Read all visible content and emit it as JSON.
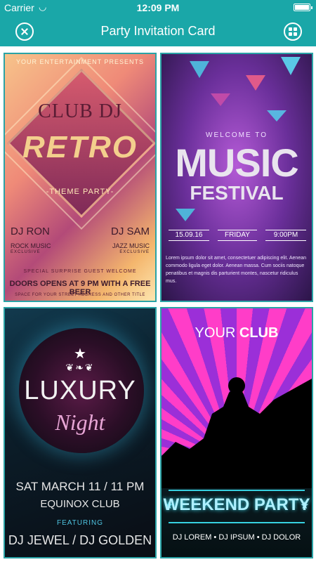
{
  "status_bar": {
    "carrier": "Carrier",
    "time": "12:09 PM"
  },
  "nav": {
    "title": "Party Invitation Card",
    "left_icon": "close-icon",
    "right_icon": "grid-icon"
  },
  "cards": [
    {
      "presents": "YOUR ENTERTAINMENT PRESENTS",
      "club_dj": "CLUB DJ",
      "retro": "RETRO",
      "theme": "-THEME PARTY-",
      "dj_left": "DJ RON",
      "dj_left_genre": "ROCK MUSIC",
      "dj_left_tag": "EXCLUSIVE",
      "dj_right": "DJ SAM",
      "dj_right_genre": "JAZZ MUSIC",
      "dj_right_tag": "EXCLUSIVE",
      "special": "SPECIAL SURPRISE GUEST WELCOME",
      "doors": "DOORS OPENS AT 9 PM WITH A FREE BEER",
      "space": "SPACE FOR YOUR STREET ADDRESS AND OTHER TITLE"
    },
    {
      "welcome": "WELCOME TO",
      "music": "MUSIC",
      "festival": "FESTIVAL",
      "date": "15.09.16",
      "day": "FRIDAY",
      "time": "9:00PM",
      "lorem": "Lorem ipsum dolor sit amet, consectetuer adipiscing elit. Aenean commodo ligula eget dolor. Aenean massa. Cum sociis natoque penatibus et magnis dis parturient montes, nascetur ridiculus mus."
    },
    {
      "luxury": "LUXURY",
      "night": "Night",
      "date": "SAT MARCH 11  / 11 PM",
      "venue": "EQUINOX CLUB",
      "featuring": "FEATURING",
      "djs": "DJ JEWEL / DJ GOLDEN"
    },
    {
      "your": "YOUR ",
      "club": "CLUB",
      "weekend": "WEEKEND PARTY",
      "djs": "DJ LOREM • DJ IPSUM • DJ DOLOR"
    }
  ]
}
